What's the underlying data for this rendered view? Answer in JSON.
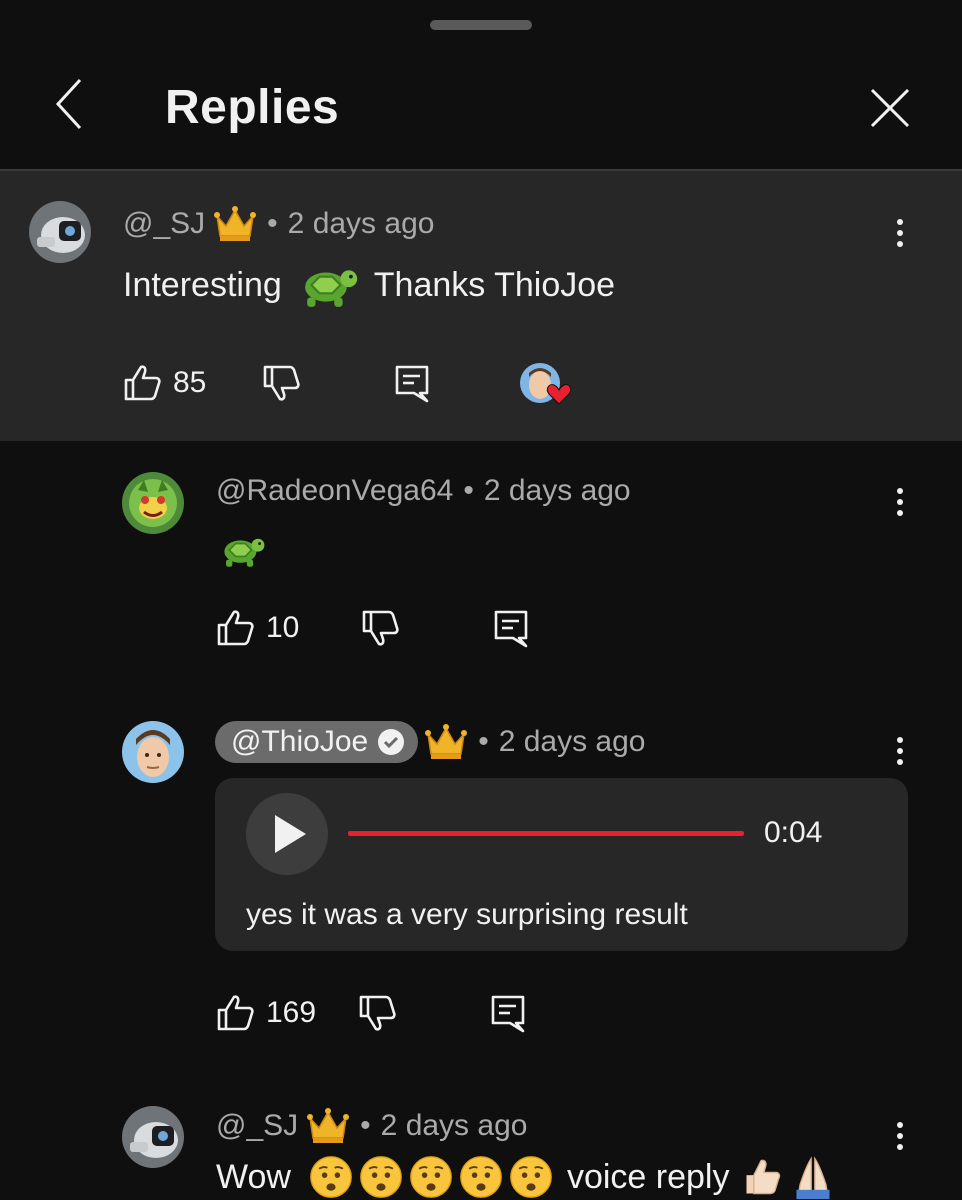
{
  "header": {
    "title": "Replies"
  },
  "comments": [
    {
      "handle": "@_SJ",
      "time": "2 days ago",
      "text_parts": [
        "Interesting",
        "Thanks ThioJoe"
      ],
      "likes": "85",
      "creator_hearted": true
    },
    {
      "handle": "@RadeonVega64",
      "time": "2 days ago",
      "text": "🐢",
      "likes": "10"
    },
    {
      "handle": "@ThioJoe",
      "time": "2 days ago",
      "verified": true,
      "voice_reply": {
        "duration": "0:04",
        "transcript": "yes it was a very surprising result"
      },
      "likes": "169"
    },
    {
      "handle": "@_SJ",
      "time": "2 days ago",
      "text_parts": [
        "Wow",
        "voice reply"
      ]
    }
  ],
  "separator": "•",
  "icons": {
    "back": "chevron-left-icon",
    "close": "close-icon",
    "like": "thumbs-up-icon",
    "dislike": "thumbs-down-icon",
    "reply": "comment-icon",
    "more": "more-vert-icon",
    "crown": "crown-icon",
    "verified": "verified-check-icon",
    "turtle": "turtle-emoji-icon",
    "heart": "heart-icon"
  },
  "colors": {
    "background": "#0f0f0f",
    "highlight": "#272727",
    "progress": "#e8202f",
    "heart": "#e8202f",
    "crown": "#f0b429"
  }
}
